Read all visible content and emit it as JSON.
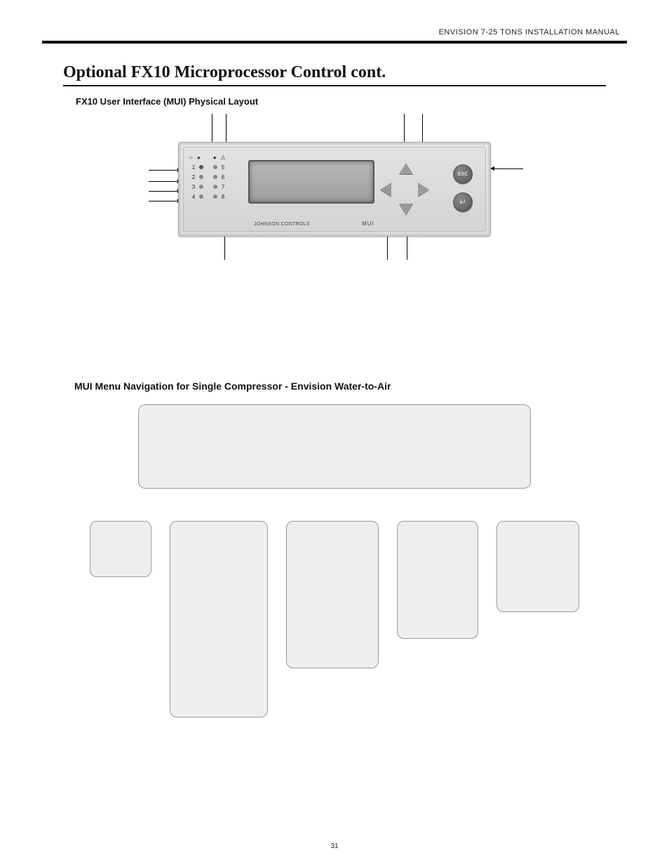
{
  "header": {
    "doc_title": "ENVISION 7-25 TONS INSTALLATION MANUAL"
  },
  "section": {
    "title": "Optional FX10 Microprocessor Control cont.",
    "subheading_layout": "FX10 User Interface (MUI) Physical Layout",
    "subheading_nav": "MUI Menu Navigation for Single Compressor  - Envision Water-to-Air"
  },
  "device": {
    "brand_text": "JOHNSON CONTROLS",
    "mui_label": "MUI",
    "esc_label": "ESC",
    "enter_symbol": "↵",
    "leds": {
      "left_numbers": [
        "1",
        "2",
        "3",
        "4"
      ],
      "right_numbers": [
        "5",
        "6",
        "7",
        "8"
      ],
      "top_symbols": [
        "○",
        "●",
        "●",
        "⚠"
      ]
    }
  },
  "page_number": "31"
}
